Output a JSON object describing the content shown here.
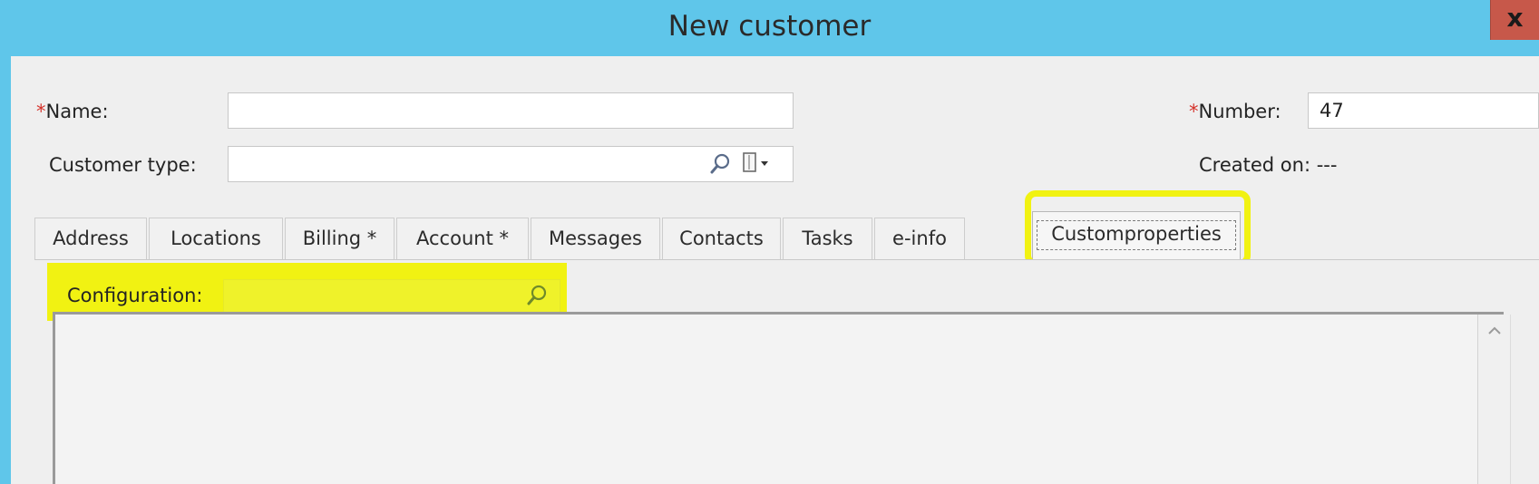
{
  "window": {
    "title": "New customer",
    "close_label": "x"
  },
  "form": {
    "name": {
      "required_marker": "*",
      "label": "Name:",
      "value": ""
    },
    "customer_type": {
      "label": "Customer type:",
      "value": ""
    },
    "number": {
      "required_marker": "*",
      "label": "Number:",
      "value": "47"
    },
    "created_on": "Created on: ---"
  },
  "tabs": [
    {
      "label": "Address"
    },
    {
      "label": "Locations"
    },
    {
      "label": "Billing *"
    },
    {
      "label": "Account *"
    },
    {
      "label": "Messages"
    },
    {
      "label": "Contacts"
    },
    {
      "label": "Tasks"
    },
    {
      "label": "e-info"
    },
    {
      "label": "Customproperties",
      "active": true
    }
  ],
  "custom_properties": {
    "configuration_label": "Configuration:",
    "configuration_value": ""
  },
  "colors": {
    "titlebar": "#5fc6ea",
    "highlight": "#f1f212",
    "required": "#d5332b",
    "close_button": "#c7584a"
  },
  "icons": {
    "lookup": "magnifier-icon",
    "dropdown": "document-dropdown-icon",
    "close": "close-icon",
    "scroll_up": "chevron-up-icon"
  }
}
